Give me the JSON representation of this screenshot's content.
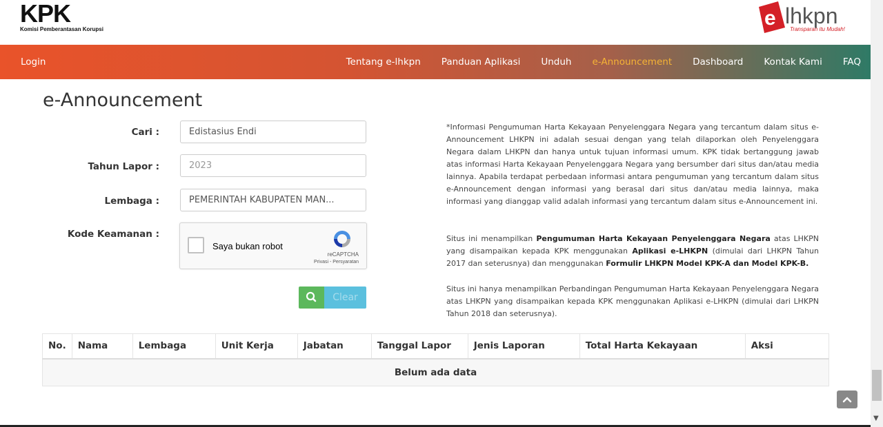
{
  "header": {
    "kpk_logo": "KPK",
    "kpk_subtitle": "Komisi Pemberantasan Korupsi",
    "elhkpn_logo": "elhkpn",
    "elhkpn_tagline": "Transparan itu Mudah!"
  },
  "nav": {
    "login": "Login",
    "items": [
      "Tentang e-lhkpn",
      "Panduan Aplikasi",
      "Unduh",
      "e-Announcement",
      "Dashboard",
      "Kontak Kami",
      "FAQ"
    ],
    "active_color": "#f5b335"
  },
  "page": {
    "title": "e-Announcement"
  },
  "form": {
    "cari_label": "Cari :",
    "cari_value": "Edistasius Endi",
    "tahun_label": "Tahun Lapor :",
    "tahun_value": "2023",
    "lembaga_label": "Lembaga :",
    "lembaga_value": "PEMERINTAH KABUPATEN MAN...",
    "kode_label": "Kode Keamanan :",
    "captcha_label": "Saya bukan robot",
    "captcha_brand": "reCAPTCHA",
    "captcha_links": "Privasi - Persyaratan",
    "search_icon": "search-icon",
    "clear_label": "Clear"
  },
  "info": {
    "p1": "*Informasi Pengumuman Harta Kekayaan Penyelenggara Negara yang tercantum dalam situs e-Announcement LHKPN ini adalah sesuai dengan yang telah dilaporkan oleh Penyelenggara Negara dalam LHKPN dan hanya untuk tujuan informasi umum. KPK tidak bertanggung jawab atas informasi Harta Kekayaan Penyelenggara Negara yang bersumber dari situs dan/atau media lainnya. Apabila terdapat perbedaan informasi antara pengumuman yang tercantum dalam situs e-Announcement dengan informasi yang berasal dari situs dan/atau media lainnya, maka informasi yang dianggap valid adalah informasi yang tercantum dalam situs e-Announcement ini.",
    "p2_a": "Situs ini menampilkan ",
    "p2_b": "Pengumuman Harta Kekayaan Penyelenggara Negara",
    "p2_c": " atas LHKPN yang disampaikan kepada KPK menggunakan ",
    "p2_d": "Aplikasi e-LHKPN",
    "p2_e": " (dimulai dari LHKPN Tahun 2017 dan seterusnya) dan menggunakan ",
    "p2_f": "Formulir LHKPN Model KPK-A dan Model KPK-B.",
    "p3": "Situs ini hanya menampilkan Perbandingan Pengumuman Harta Kekayaan Penyelenggara Negara atas LHKPN yang disampaikan kepada KPK menggunakan Aplikasi e-LHKPN (dimulai dari LHKPN Tahun 2018 dan seterusnya)."
  },
  "table": {
    "headers": [
      "No.",
      "Nama",
      "Lembaga",
      "Unit Kerja",
      "Jabatan",
      "Tanggal Lapor",
      "Jenis Laporan",
      "Total Harta Kekayaan",
      "Aksi"
    ],
    "empty_text": "Belum ada data"
  }
}
